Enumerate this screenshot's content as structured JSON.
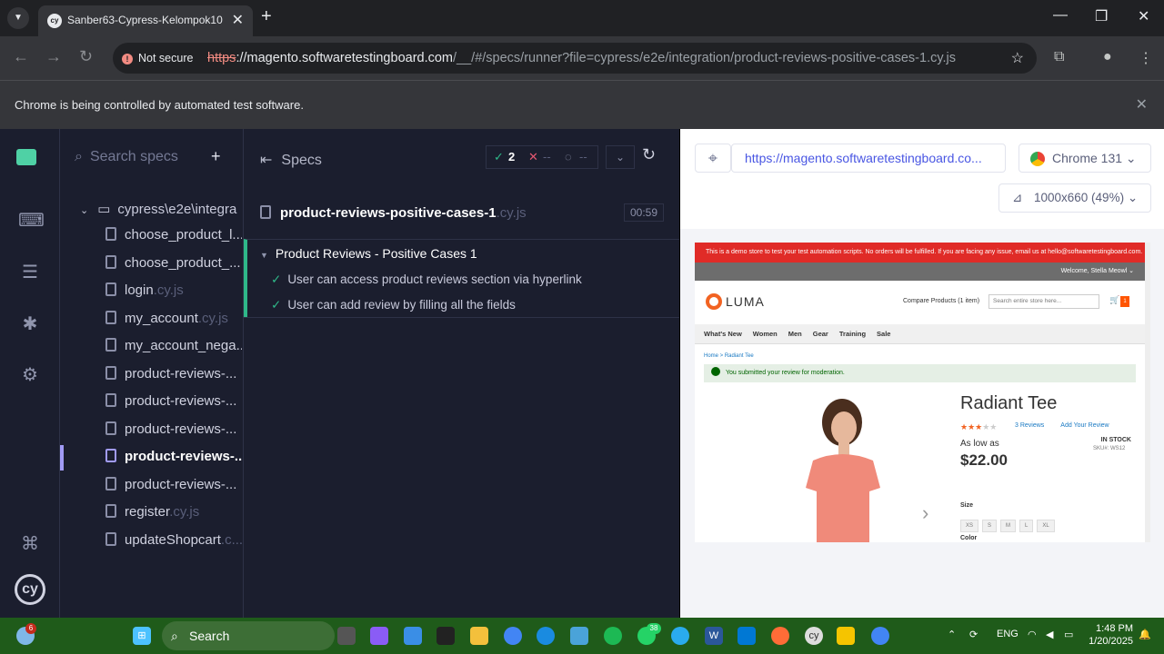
{
  "browser": {
    "tab_title": "Sanber63-Cypress-Kelompok10",
    "not_secure_label": "Not secure",
    "url_scheme": "https",
    "url_host": "://magento.softwaretestingboard.com",
    "url_path": "/__/#/specs/runner?file=cypress/e2e/integration/product-reviews-positive-cases-1.cy.js",
    "infobar_message": "Chrome is being controlled by automated test software."
  },
  "sidebar": {
    "search_placeholder": "Search specs",
    "folder": "cypress\\e2e\\integra",
    "files": [
      {
        "name": "choose_product_l...",
        "ext": ""
      },
      {
        "name": "choose_product_...",
        "ext": ""
      },
      {
        "name": "login",
        "ext": ".cy.js"
      },
      {
        "name": "my_account",
        "ext": ".cy.js"
      },
      {
        "name": "my_account_nega...",
        "ext": ""
      },
      {
        "name": "product-reviews-...",
        "ext": ""
      },
      {
        "name": "product-reviews-...",
        "ext": ""
      },
      {
        "name": "product-reviews-...",
        "ext": ""
      },
      {
        "name": "product-reviews-...",
        "ext": ""
      },
      {
        "name": "product-reviews-...",
        "ext": ""
      },
      {
        "name": "register",
        "ext": ".cy.js"
      },
      {
        "name": "updateShopcart",
        "ext": ".c..."
      }
    ]
  },
  "runner": {
    "header": "Specs",
    "passed": "2",
    "failed": "--",
    "pending": "--",
    "spec_name": "product-reviews-positive-cases-1",
    "spec_ext": ".cy.js",
    "duration": "00:59",
    "suite": "Product Reviews - Positive Cases 1",
    "tests": [
      "User can access product reviews section via hyperlink",
      "User can add review by filling all the fields"
    ]
  },
  "preview": {
    "url": "https://magento.softwaretestingboard.co...",
    "browser": "Chrome 131",
    "viewport": "1000x660 (49%)",
    "demo_notice": "This is a demo store to test your test automation scripts. No orders will be fulfilled. If you are facing any issue, email us at hello@softwaretestingboard.com.",
    "welcome": "Welcome, Stella Meowl",
    "logo": "LUMA",
    "compare": "Compare Products (1 item)",
    "search_placeholder": "Search entire store here...",
    "cart_count": "1",
    "nav": [
      "What's New",
      "Women",
      "Men",
      "Gear",
      "Training",
      "Sale"
    ],
    "breadcrumb": "Home  >  Radiant Tee",
    "success_msg": "You submitted your review for moderation.",
    "product_title": "Radiant Tee",
    "reviews_link": "3  Reviews",
    "add_review_link": "Add Your Review",
    "as_low_as": "As low as",
    "price": "$22.00",
    "in_stock": "IN STOCK",
    "sku": "SKU#:   WS12",
    "size_label": "Size",
    "sizes": [
      "XS",
      "S",
      "M",
      "L",
      "XL"
    ],
    "color_label": "Color"
  },
  "taskbar": {
    "search": "Search",
    "lang": "ENG",
    "time": "1:48 PM",
    "date": "1/20/2025",
    "weather_badge": "6",
    "whatsapp_badge": "38"
  }
}
